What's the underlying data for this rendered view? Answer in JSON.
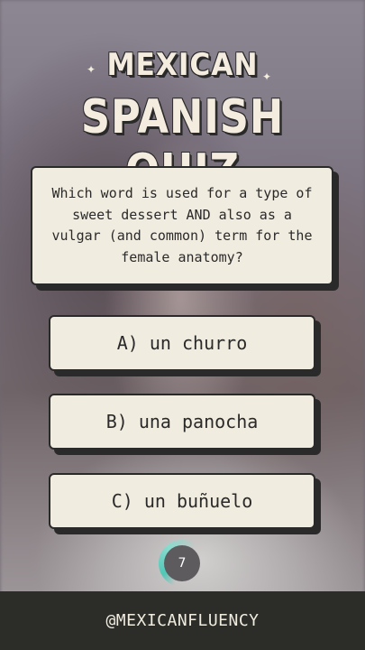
{
  "header": {
    "title_line1": "MEXICAN",
    "title_line2": "SPANISH QUIZ",
    "sparkle_glyph": "✦"
  },
  "question": {
    "text": "Which word is used for a type of sweet dessert AND also as a vulgar (and common) term for the female anatomy?"
  },
  "answers": [
    {
      "label": "A) un churro"
    },
    {
      "label": "B) una panocha"
    },
    {
      "label": "C) un buñuelo"
    }
  ],
  "timer": {
    "value": "7",
    "ring_color": "#3cc8b4"
  },
  "footer": {
    "handle": "@MEXICANFLUENCY"
  },
  "colors": {
    "card_bg": "#f1ece0",
    "outline": "#2b2a2a",
    "footer_bg": "#2c2d28"
  }
}
